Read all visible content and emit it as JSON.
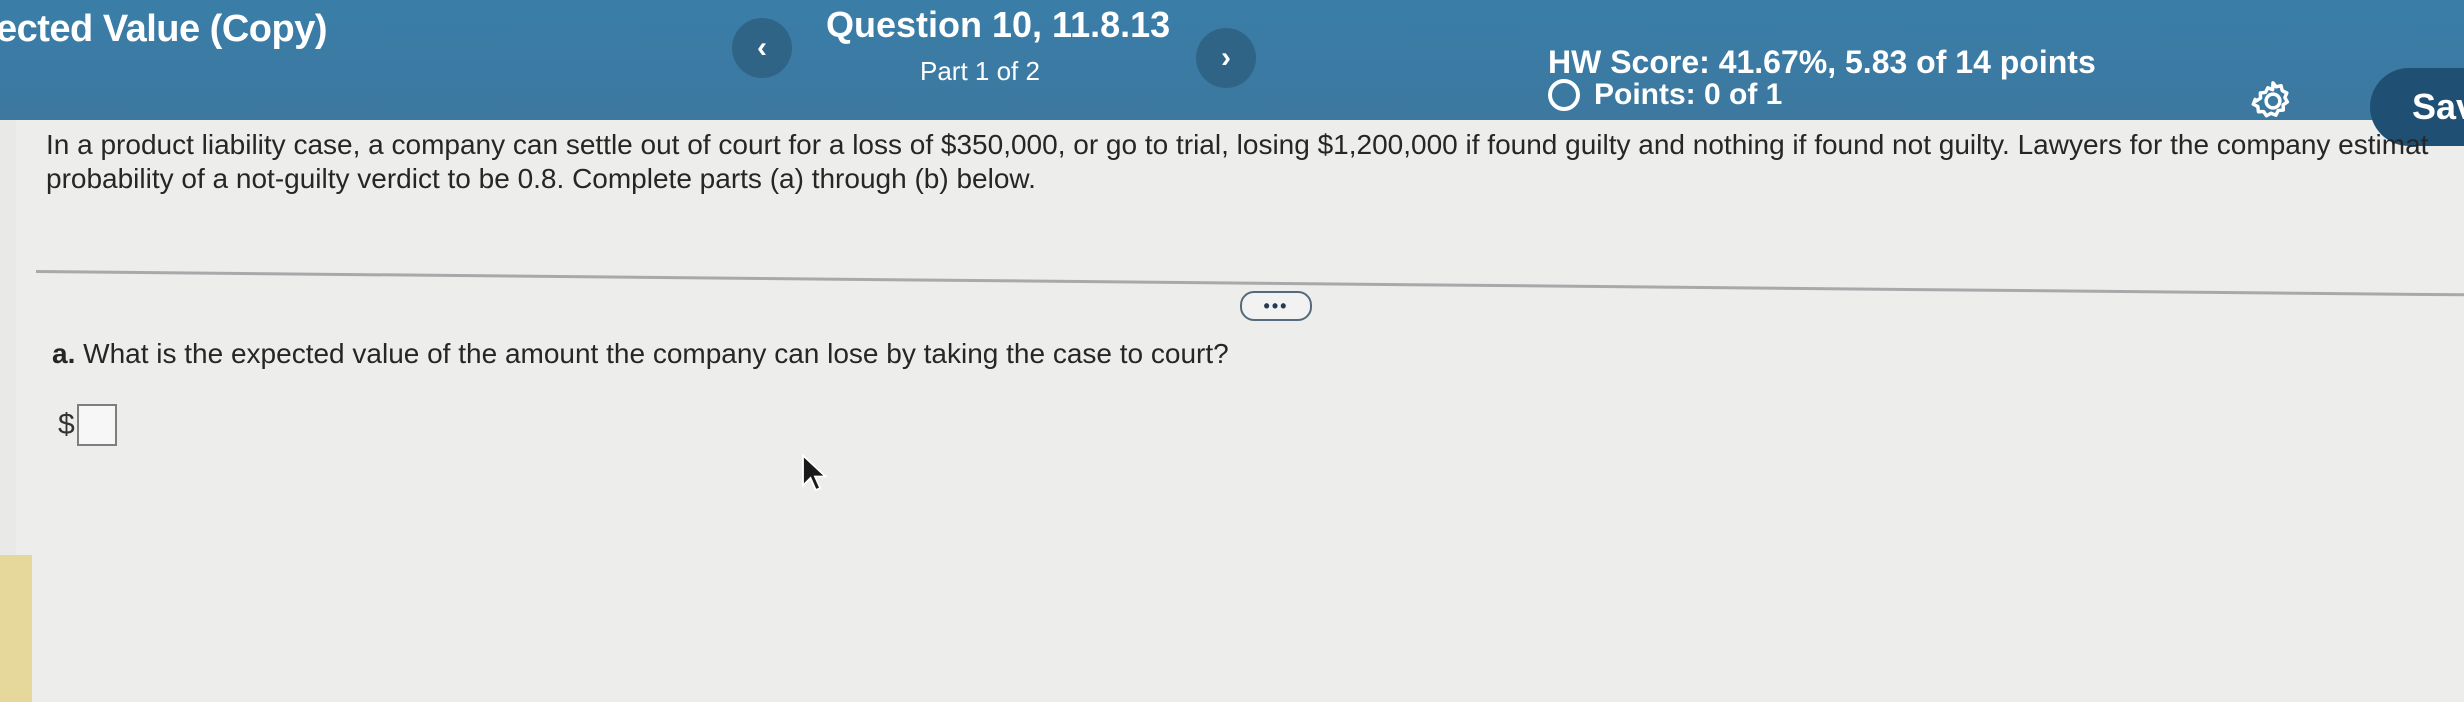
{
  "header": {
    "assignment_title": "ected Value (Copy)",
    "prev_label": "‹",
    "next_label": "›",
    "question_title": "Question 10, 11.8.13",
    "question_part": "Part 1 of 2",
    "hw_score": "HW Score: 41.67%, 5.83 of 14 points",
    "points": "Points: 0 of 1",
    "save_label": "Sav",
    "colors": {
      "header_bg": "#3a7ea8",
      "save_bg": "#1f4f73"
    }
  },
  "problem": {
    "line1": "In a product liability case, a company can settle out of court for a loss of $350,000, or go to trial, losing $1,200,000 if found guilty and nothing if found not guilty. Lawyers for the company estimat",
    "line2": "probability of a not-guilty verdict to be 0.8. Complete parts (a) through (b) below."
  },
  "more_label": "•••",
  "part_a": {
    "label": "a.",
    "question": "What is the expected value of the amount the company can lose by taking the case to court?"
  },
  "answer": {
    "prefix": "$",
    "value": ""
  }
}
